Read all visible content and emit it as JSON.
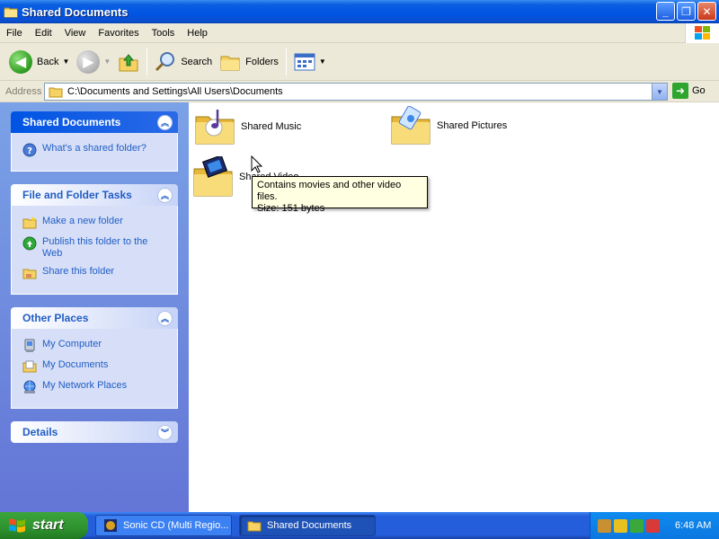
{
  "window": {
    "title": "Shared Documents"
  },
  "menu": [
    "File",
    "Edit",
    "View",
    "Favorites",
    "Tools",
    "Help"
  ],
  "toolbar": {
    "back": "Back",
    "search": "Search",
    "folders": "Folders"
  },
  "address": {
    "label": "Address",
    "path": "C:\\Documents and Settings\\All Users\\Documents",
    "go": "Go"
  },
  "left_pane": {
    "panel1": {
      "title": "Shared Documents",
      "items": [
        "What's a shared folder?"
      ]
    },
    "panel2": {
      "title": "File and Folder Tasks",
      "items": [
        "Make a new folder",
        "Publish this folder to the Web",
        "Share this folder"
      ]
    },
    "panel3": {
      "title": "Other Places",
      "items": [
        "My Computer",
        "My Documents",
        "My Network Places"
      ]
    },
    "panel4": {
      "title": "Details"
    }
  },
  "folders": [
    "Shared Music",
    "Shared Pictures",
    "Shared Video"
  ],
  "tooltip": {
    "line1": "Contains movies and other video files.",
    "line2": "Size: 151 bytes"
  },
  "taskbar": {
    "start": "start",
    "tasks": [
      "Sonic CD (Multi Regio...",
      "Shared Documents"
    ],
    "clock": "6:48 AM"
  },
  "colors": {
    "titlebar": "#0054e3",
    "taskbar": "#245edb",
    "start": "#3ca53c",
    "leftpane": "#7ba2e7",
    "link": "#215dc6",
    "tooltip_bg": "#ffffe1"
  }
}
